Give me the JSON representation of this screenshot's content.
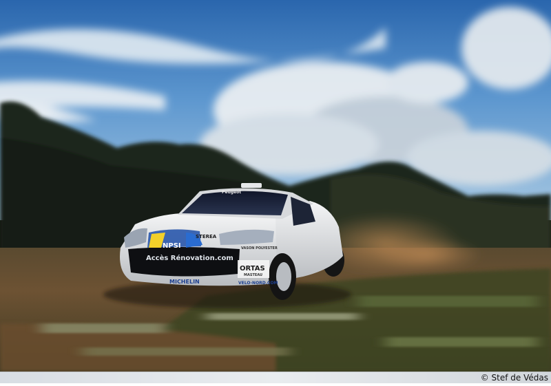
{
  "photo": {
    "subject": "rally-car",
    "sponsors": {
      "windshield": "Peugeot",
      "hood_left": "NPSI",
      "hood_right": "STEREA",
      "bumper": "Accès Rénovation.com",
      "lower_left": "MICHELIN",
      "door_brand": "ORTAS",
      "door_small": "MASTEAU",
      "door_mid": "VASON POLYESTER",
      "door_url": "VELO-NORD.COM"
    }
  },
  "credit": {
    "text": "© Stef de Védas"
  },
  "colors": {
    "sky_top": "#2f6fb3",
    "sky_light": "#9fc6e6",
    "cloud": "#eef2f4",
    "trees": "#20281c",
    "dirt": "#7a5a36",
    "car_white": "#e8e9ea"
  }
}
